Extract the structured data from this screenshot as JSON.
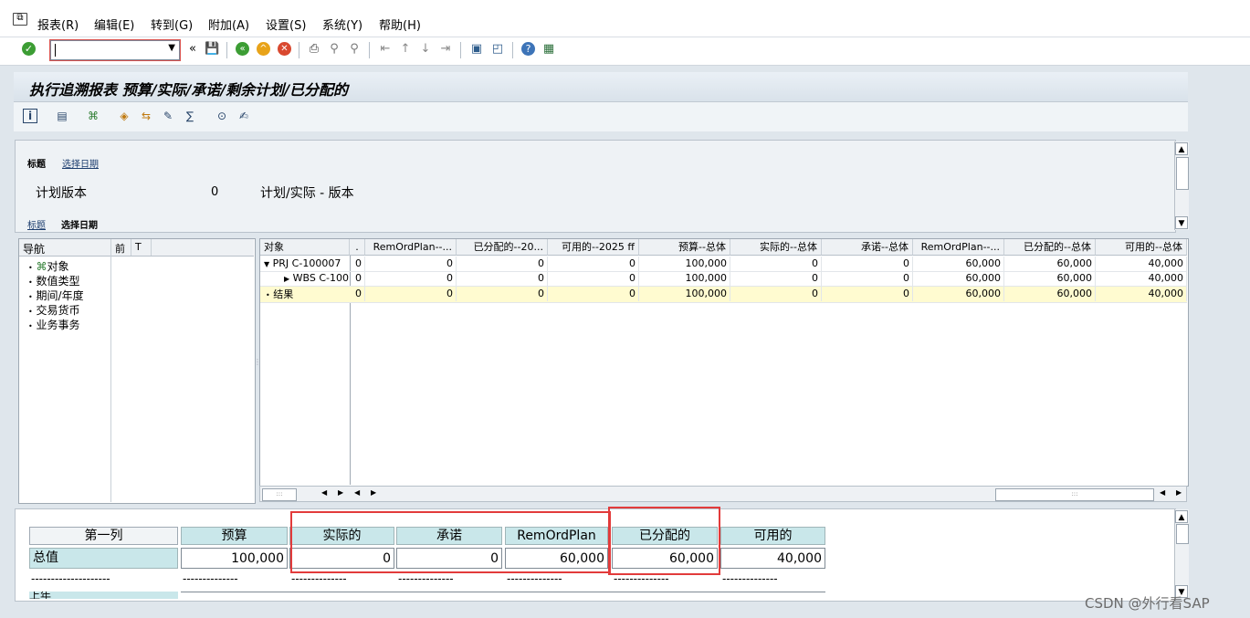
{
  "menu": [
    "报表(R)",
    "编辑(E)",
    "转到(G)",
    "附加(A)",
    "设置(S)",
    "系统(Y)",
    "帮助(H)"
  ],
  "toolbar_icons": [
    "check-icon",
    "collapse-icon",
    "save-icon",
    "back-icon",
    "exit-icon",
    "cancel-icon",
    "print-icon",
    "find-icon",
    "find-next-icon",
    "first-page-icon",
    "prev-page-icon",
    "next-page-icon",
    "last-page-icon",
    "new-session-icon",
    "shortcut-icon",
    "help-icon",
    "customize-layout-icon"
  ],
  "page": {
    "title": "执行追溯报表 预算/实际/承诺/剩余计划/已分配的"
  },
  "header": {
    "tab_title": "标题",
    "tab_select_date": "选择日期",
    "plan_version_label": "计划版本",
    "plan_version_value": "0",
    "plan_version_text": "计划/实际 - 版本"
  },
  "nav": {
    "header": "导航",
    "col2": "前",
    "col3": "T",
    "items": [
      "对象",
      "数值类型",
      "期间/年度",
      "交易货币",
      "业务事务"
    ]
  },
  "grid": {
    "columns": [
      "对象",
      ".",
      "RemOrdPlan--...",
      "已分配的--20...",
      "可用的--2025 ff",
      "预算--总体",
      "实际的--总体",
      "承诺--总体",
      "RemOrdPlan--...",
      "已分配的--总体",
      "可用的--总体"
    ],
    "rows": [
      {
        "obj": "PRJ C-100007",
        "vals": [
          "0",
          "0",
          "0",
          "0",
          "100,000",
          "0",
          "0",
          "60,000",
          "60,000",
          "40,000"
        ]
      },
      {
        "obj": "WBS C-100",
        "vals": [
          "0",
          "0",
          "0",
          "0",
          "100,000",
          "0",
          "0",
          "60,000",
          "60,000",
          "40,000"
        ]
      },
      {
        "obj": "结果",
        "vals": [
          "0",
          "0",
          "0",
          "0",
          "100,000",
          "0",
          "0",
          "60,000",
          "60,000",
          "40,000"
        ]
      }
    ]
  },
  "bottom": {
    "headers": [
      "第一列",
      "预算",
      "实际的",
      "承诺",
      "RemOrdPlan",
      "已分配的",
      "可用的"
    ],
    "row_label": "总值",
    "values": [
      "100,000",
      "0",
      "0",
      "60,000",
      "60,000",
      "40,000"
    ],
    "dash_first": "--------------------",
    "dash": "--------------",
    "partial_label": "上年"
  },
  "watermark": "CSDN @外行看SAP",
  "colors": {
    "highlight_row": "#fffbd0",
    "header_cell": "#c9e7ea",
    "annotation_red": "#e23b3b"
  }
}
